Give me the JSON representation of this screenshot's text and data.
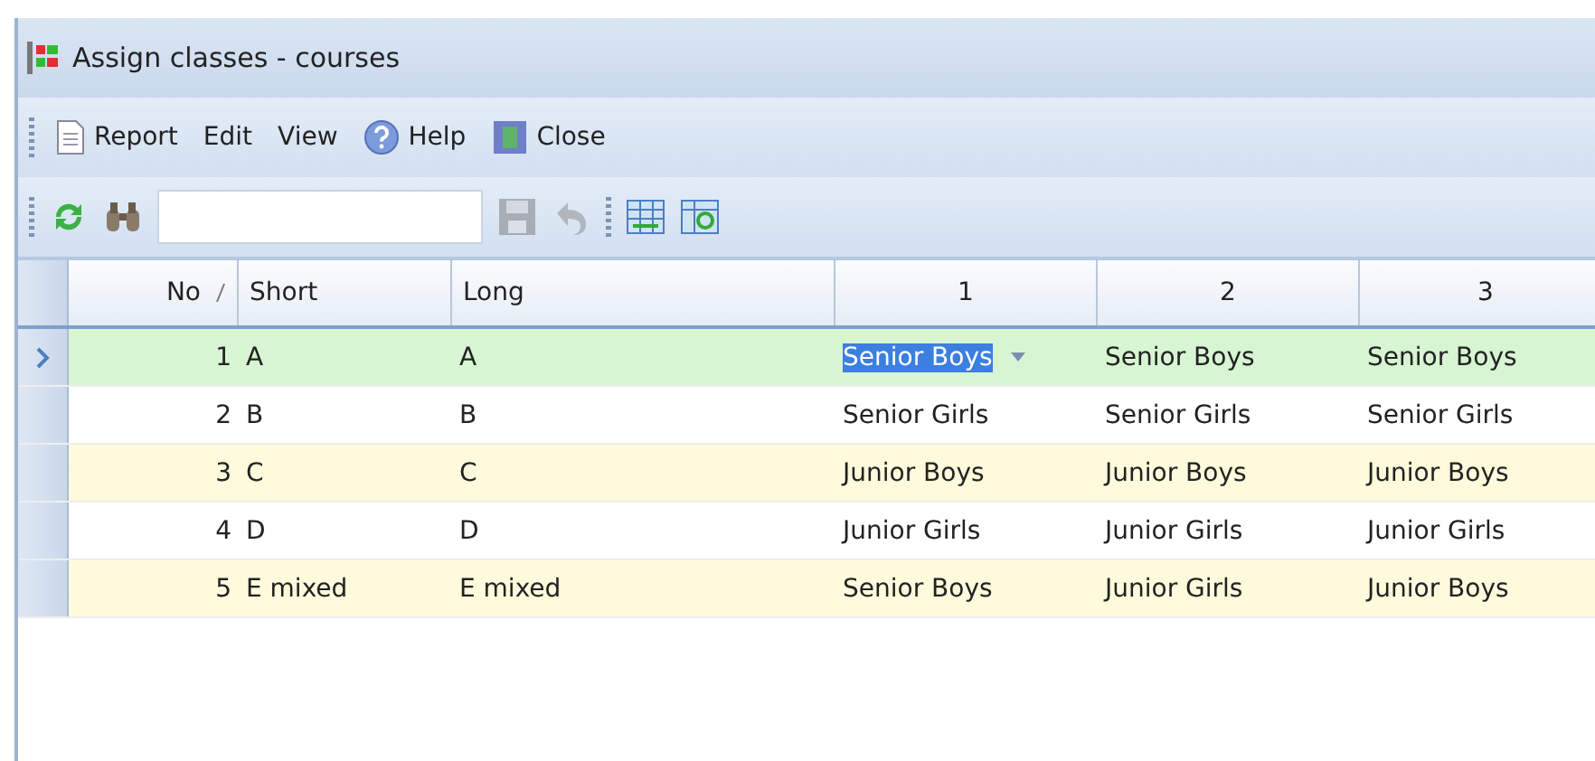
{
  "window": {
    "title": "Assign classes - courses"
  },
  "menu": [
    {
      "label": "Report"
    },
    {
      "label": "Edit"
    },
    {
      "label": "View"
    },
    {
      "label": "Help"
    },
    {
      "label": "Close"
    }
  ],
  "toolbar": {
    "save_disabled": true,
    "undo_disabled": true
  },
  "table": {
    "columns": [
      {
        "label": "No",
        "sorted": true
      },
      {
        "label": "Short",
        "sorted": false
      },
      {
        "label": "Long",
        "sorted": false
      },
      {
        "label": "1",
        "sorted": false
      },
      {
        "label": "2",
        "sorted": false
      },
      {
        "label": "3",
        "sorted": false
      }
    ],
    "rows": [
      {
        "selected": true,
        "editing": true,
        "cells": [
          "1",
          "A",
          "A",
          "Senior Boys",
          "Senior Boys",
          "Senior Boys"
        ]
      },
      {
        "selected": false,
        "editing": false,
        "cells": [
          "2",
          "B",
          "B",
          "Senior Girls",
          "Senior Girls",
          "Senior Girls"
        ]
      },
      {
        "selected": false,
        "editing": false,
        "cells": [
          "3",
          "C",
          "C",
          "Junior Boys",
          "Junior Boys",
          "Junior Boys"
        ]
      },
      {
        "selected": false,
        "editing": false,
        "cells": [
          "4",
          "D",
          "D",
          "Junior Girls",
          "Junior Girls",
          "Junior Girls"
        ]
      },
      {
        "selected": false,
        "editing": false,
        "cells": [
          "5",
          "E mixed",
          "E mixed",
          "Senior Boys",
          "Junior Girls",
          "Junior Boys"
        ]
      }
    ]
  }
}
